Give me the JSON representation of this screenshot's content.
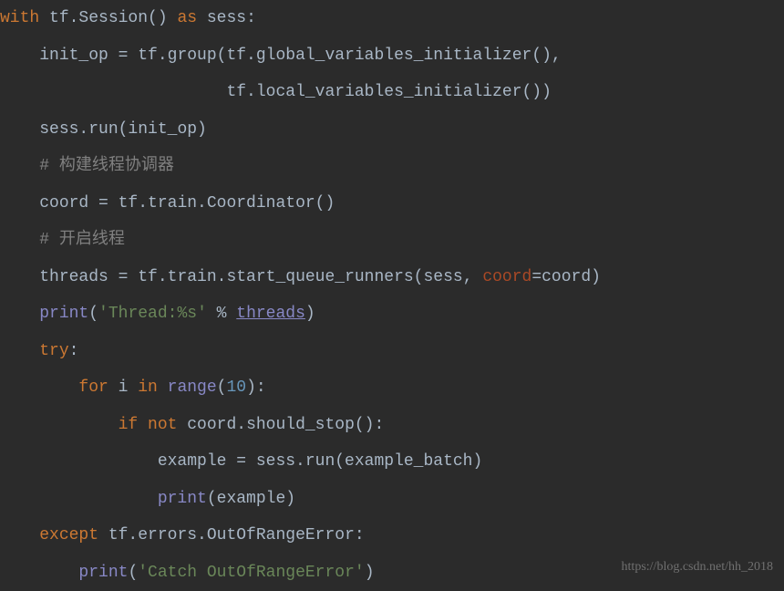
{
  "code": {
    "line1": {
      "kw_with": "with",
      "tf_session": " tf.Session() ",
      "kw_as": "as",
      "sess": " sess:"
    },
    "line2": {
      "indent": "    ",
      "text": "init_op = tf.group(tf.global_variables_initializer(),"
    },
    "line3": {
      "indent": "                       ",
      "text": "tf.local_variables_initializer())"
    },
    "line4": {
      "indent": "    ",
      "text": "sess.run(init_op)"
    },
    "line5": {
      "indent": "    ",
      "comment": "# 构建线程协调器"
    },
    "line6": {
      "indent": "    ",
      "text": "coord = tf.train.Coordinator()"
    },
    "line7": {
      "indent": "    ",
      "comment": "# 开启线程"
    },
    "line8": {
      "indent": "    ",
      "text1": "threads = tf.train.start_queue_runners(sess, ",
      "param": "coord",
      "text2": "=coord)"
    },
    "line9": {
      "indent": "    ",
      "print": "print",
      "paren1": "(",
      "str1": "'Thread:%s'",
      "pct": " % ",
      "threads": "threads",
      "paren2": ")"
    },
    "line10": {
      "indent": "    ",
      "kw_try": "try",
      "colon": ":"
    },
    "line11": {
      "indent": "        ",
      "kw_for": "for",
      "i": " i ",
      "kw_in": "in",
      "sp": " ",
      "range": "range",
      "paren1": "(",
      "num": "10",
      "paren2": "):"
    },
    "line12": {
      "indent": "            ",
      "kw_if": "if",
      "sp": " ",
      "kw_not": "not",
      "text": " coord.should_stop():"
    },
    "line13": {
      "indent": "                ",
      "text": "example = sess.run(example_batch)"
    },
    "line14": {
      "indent": "                ",
      "print": "print",
      "text": "(example)"
    },
    "line15": {
      "indent": "    ",
      "kw_except": "except",
      "text": " tf.errors.OutOfRangeError:"
    },
    "line16": {
      "indent": "        ",
      "print": "print",
      "paren1": "(",
      "str": "'Catch OutOfRangeError'",
      "paren2": ")"
    }
  },
  "watermark": "https://blog.csdn.net/hh_2018"
}
